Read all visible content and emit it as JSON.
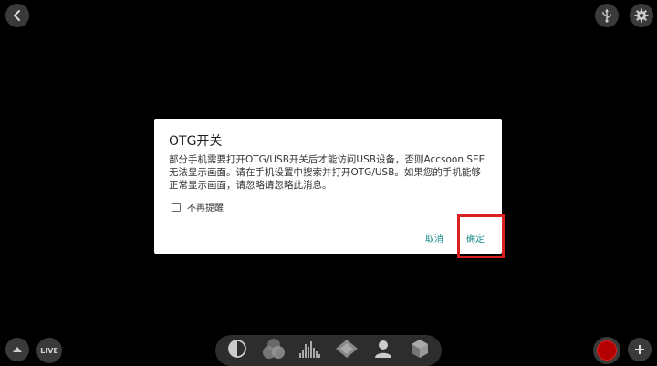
{
  "dialog": {
    "title": "OTG开关",
    "message": "部分手机需要打开OTG/USB开关后才能访问USB设备，否则Accsoon SEE 无法显示画面。请在手机设置中搜索并打开OTG/USB。如果您的手机能够正常显示画面，请忽略请忽略此消息。",
    "checkbox_label": "不再提醒",
    "checkbox_checked": false,
    "cancel_label": "取消",
    "confirm_label": "确定"
  },
  "bottom_bar": {
    "live_label": "LIVE"
  },
  "icons": {
    "top_left": "back-chevron-icon",
    "top_right": [
      "usb-icon",
      "gear-icon"
    ],
    "bottom_left": [
      "up-arrow-icon",
      "live-icon"
    ],
    "toolbar": [
      "contrast-icon",
      "rgb-circles-icon",
      "histogram-icon",
      "vectorscope-icon",
      "person-icon",
      "cube-icon"
    ],
    "bottom_right": [
      "record-icon",
      "plus-icon"
    ]
  },
  "colors": {
    "background": "#000000",
    "dialog_button": "#1a8a8a",
    "record": "#b30000",
    "highlight": "#d92020"
  }
}
